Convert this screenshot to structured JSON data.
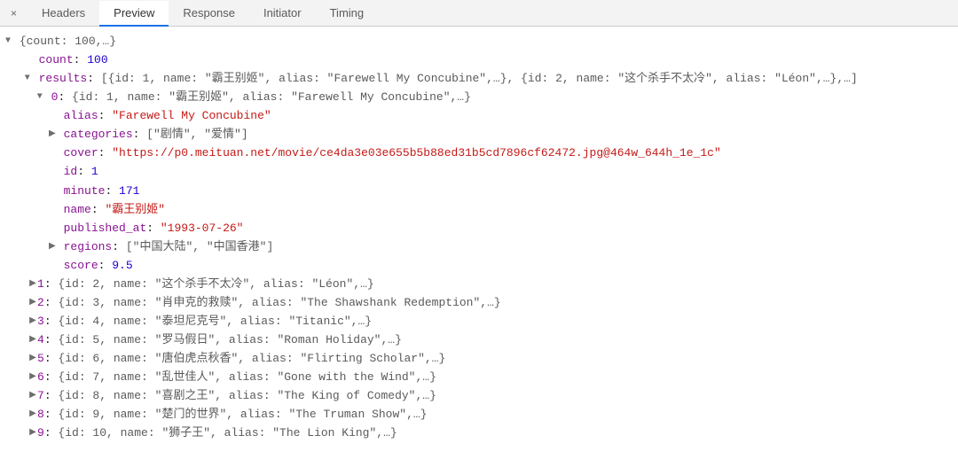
{
  "tabs": {
    "close": "×",
    "items": [
      "Headers",
      "Preview",
      "Response",
      "Initiator",
      "Timing"
    ],
    "activeIndex": 1
  },
  "tree": {
    "root_summary_open": "{count: 100,…}",
    "count_key": "count",
    "count_val": "100",
    "results_key": "results",
    "results_summary": "[{id: 1, name: \"霸王别姬\", alias: \"Farewell My Concubine\",…}, {id: 2, name: \"这个杀手不太冷\", alias: \"Léon\",…},…]",
    "item0": {
      "idx": "0",
      "summary": "{id: 1, name: \"霸王别姬\", alias: \"Farewell My Concubine\",…}",
      "alias_key": "alias",
      "alias_val": "\"Farewell My Concubine\"",
      "categories_key": "categories",
      "categories_val": "[\"剧情\", \"爱情\"]",
      "cover_key": "cover",
      "cover_val": "\"https://p0.meituan.net/movie/ce4da3e03e655b5b88ed31b5cd7896cf62472.jpg@464w_644h_1e_1c\"",
      "id_key": "id",
      "id_val": "1",
      "minute_key": "minute",
      "minute_val": "171",
      "name_key": "name",
      "name_val": "\"霸王别姬\"",
      "published_key": "published_at",
      "published_val": "\"1993-07-26\"",
      "regions_key": "regions",
      "regions_val": "[\"中国大陆\", \"中国香港\"]",
      "score_key": "score",
      "score_val": "9.5"
    },
    "rest": [
      {
        "idx": "1",
        "summary": "{id: 2, name: \"这个杀手不太冷\", alias: \"Léon\",…}"
      },
      {
        "idx": "2",
        "summary": "{id: 3, name: \"肖申克的救赎\", alias: \"The Shawshank Redemption\",…}"
      },
      {
        "idx": "3",
        "summary": "{id: 4, name: \"泰坦尼克号\", alias: \"Titanic\",…}"
      },
      {
        "idx": "4",
        "summary": "{id: 5, name: \"罗马假日\", alias: \"Roman Holiday\",…}"
      },
      {
        "idx": "5",
        "summary": "{id: 6, name: \"唐伯虎点秋香\", alias: \"Flirting Scholar\",…}"
      },
      {
        "idx": "6",
        "summary": "{id: 7, name: \"乱世佳人\", alias: \"Gone with the Wind\",…}"
      },
      {
        "idx": "7",
        "summary": "{id: 8, name: \"喜剧之王\", alias: \"The King of Comedy\",…}"
      },
      {
        "idx": "8",
        "summary": "{id: 9, name: \"楚门的世界\", alias: \"The Truman Show\",…}"
      },
      {
        "idx": "9",
        "summary": "{id: 10, name: \"狮子王\", alias: \"The Lion King\",…}"
      }
    ]
  },
  "glyphs": {
    "down": "▼",
    "right": "▶"
  }
}
